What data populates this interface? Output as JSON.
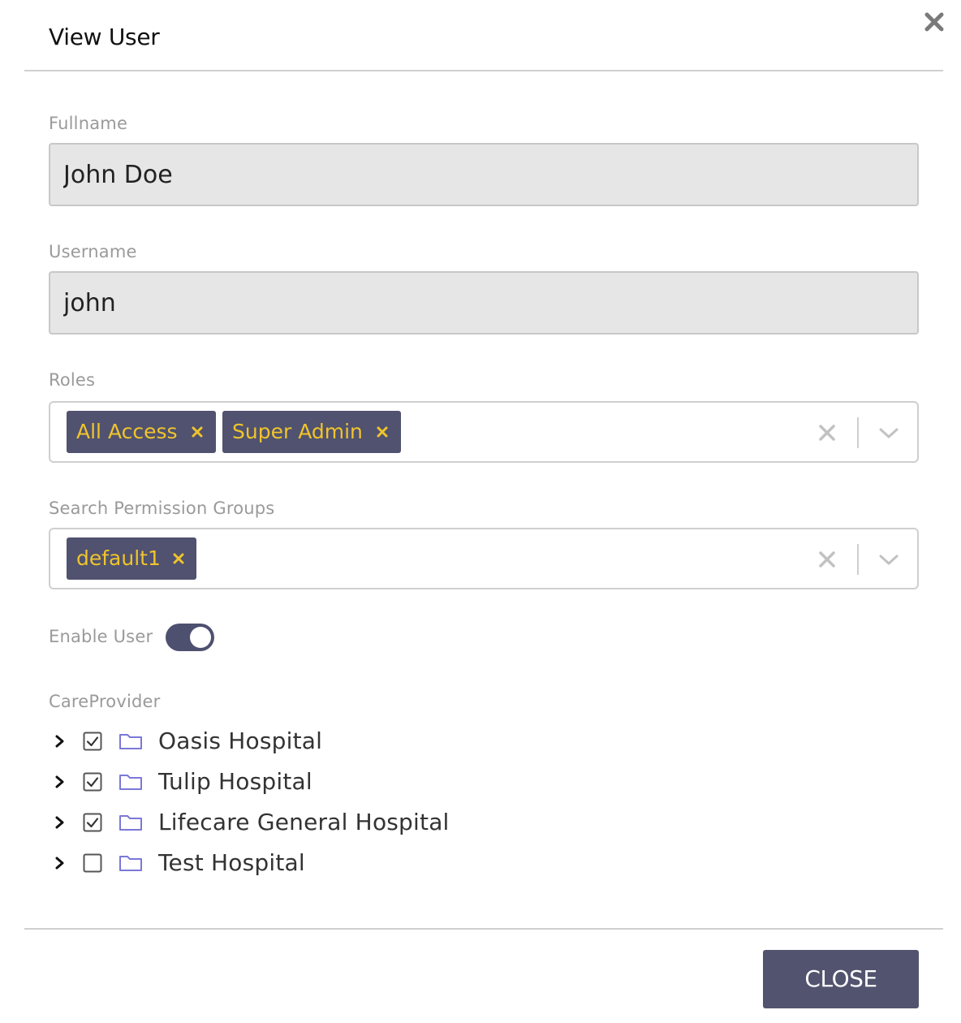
{
  "modal": {
    "title": "View User"
  },
  "fields": {
    "fullname": {
      "label": "Fullname",
      "value": "John Doe"
    },
    "username": {
      "label": "Username",
      "value": "john"
    },
    "roles": {
      "label": "Roles",
      "chips": [
        "All Access",
        "Super Admin"
      ]
    },
    "permission_groups": {
      "label": "Search Permission Groups",
      "chips": [
        "default1"
      ]
    },
    "enable_user": {
      "label": "Enable User",
      "enabled": true
    }
  },
  "care_provider": {
    "label": "CareProvider",
    "items": [
      {
        "label": "Oasis Hospital",
        "checked": true
      },
      {
        "label": "Tulip Hospital",
        "checked": true
      },
      {
        "label": "Lifecare General Hospital",
        "checked": true
      },
      {
        "label": "Test Hospital",
        "checked": false
      }
    ]
  },
  "footer": {
    "close_label": "CLOSE"
  },
  "icons": {
    "modal_close": "close-icon",
    "chip_remove": "close-icon",
    "clear": "close-icon",
    "dropdown": "chevron-down-icon",
    "tree_expand": "chevron-right-icon",
    "folder": "folder-icon",
    "checkbox": "checkbox-icon"
  },
  "colors": {
    "chip_bg": "#50526f",
    "chip_text": "#f0c42c",
    "toggle_on": "#4e5070",
    "folder": "#7b78d8",
    "close_button": "#52546f"
  }
}
